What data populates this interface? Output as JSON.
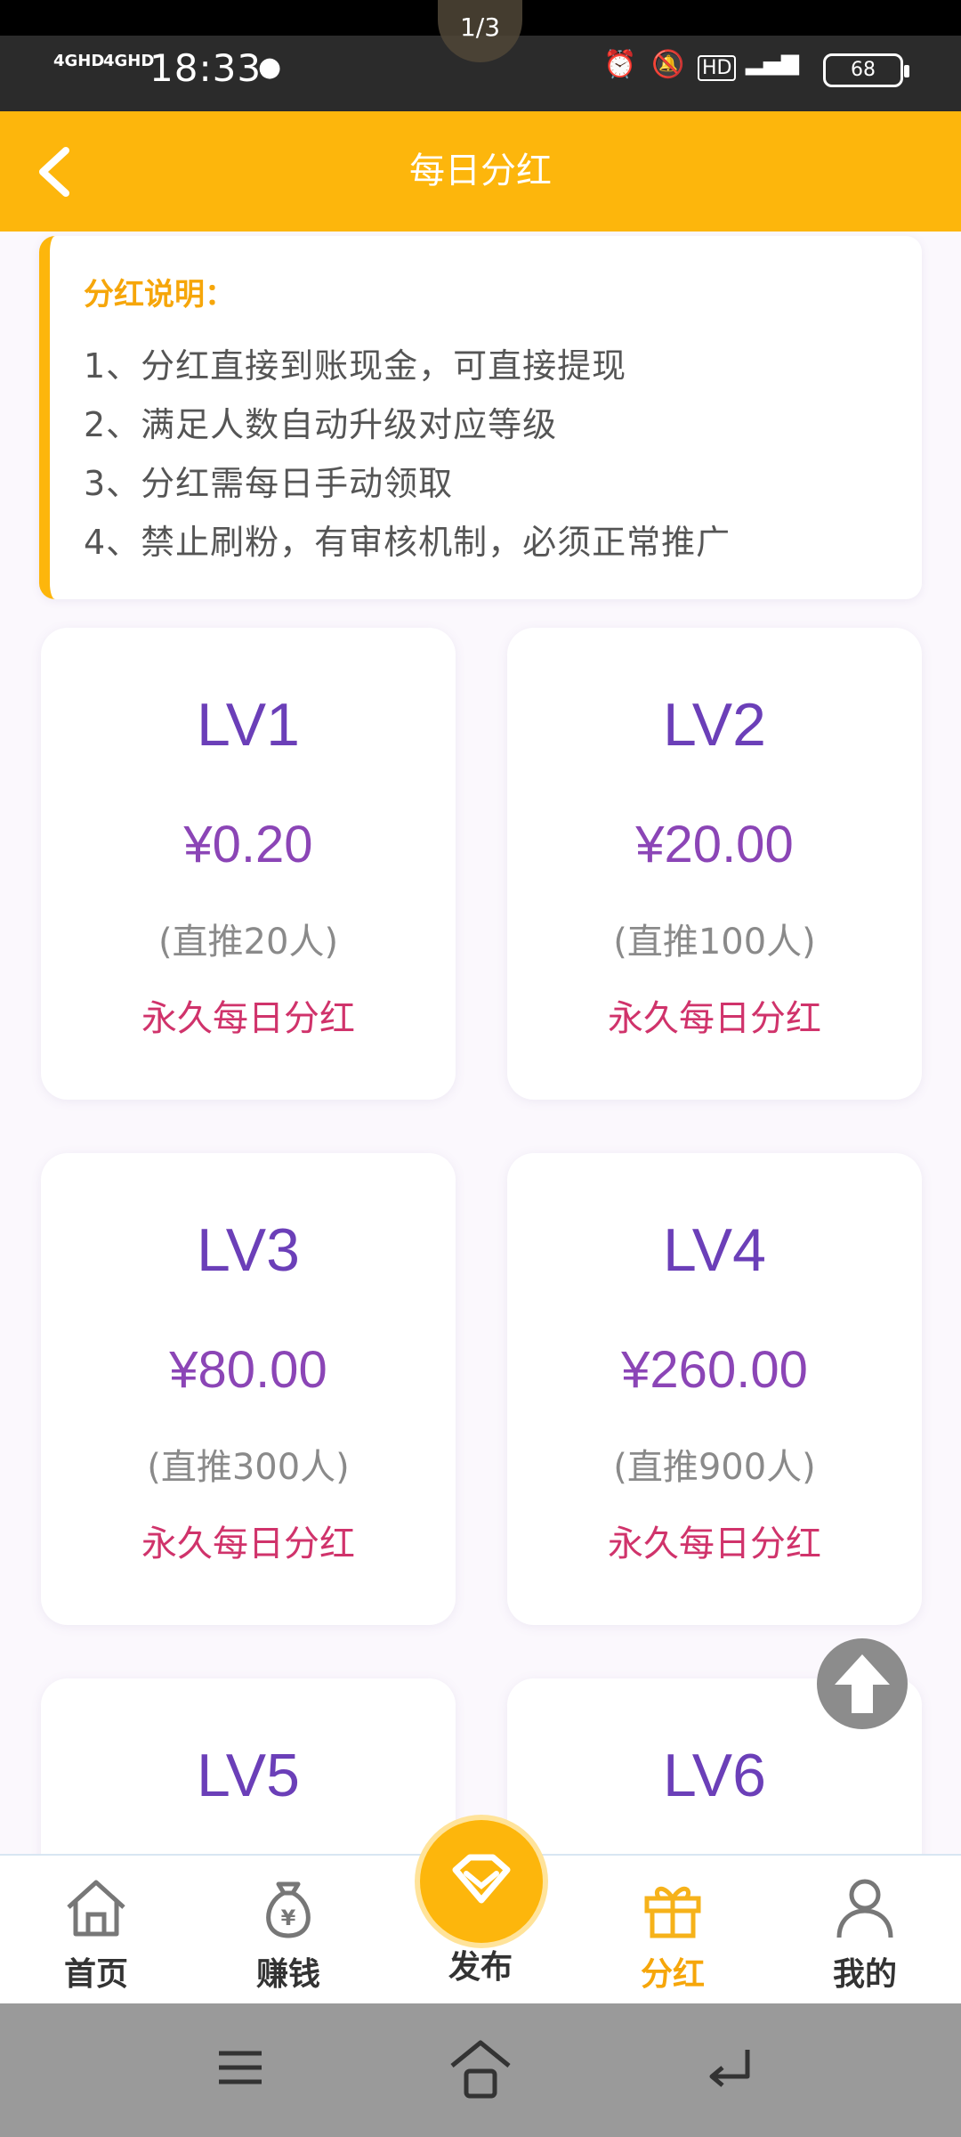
{
  "status_bar": {
    "network_1": "4GHD",
    "network_2": "4GHD",
    "time": "18:33",
    "battery": "68"
  },
  "header": {
    "title": "每日分红",
    "pager": "1/3"
  },
  "info": {
    "heading": "分红说明：",
    "lines": [
      "1、分红直接到账现金，可直接提现",
      "2、满足人数自动升级对应等级",
      "3、分红需每日手动领取",
      "4、禁止刷粉，有审核机制，必须正常推广"
    ]
  },
  "levels": [
    {
      "level": "LV1",
      "amount": "¥0.20",
      "requirement": "(直推20人)",
      "note": "永久每日分红"
    },
    {
      "level": "LV2",
      "amount": "¥20.00",
      "requirement": "(直推100人)",
      "note": "永久每日分红"
    },
    {
      "level": "LV3",
      "amount": "¥80.00",
      "requirement": "(直推300人)",
      "note": "永久每日分红"
    },
    {
      "level": "LV4",
      "amount": "¥260.00",
      "requirement": "(直推900人)",
      "note": "永久每日分红"
    },
    {
      "level": "LV5"
    },
    {
      "level": "LV6"
    }
  ],
  "tabbar": {
    "items": [
      {
        "label": "首页",
        "icon": "home-icon"
      },
      {
        "label": "赚钱",
        "icon": "money-bag-icon"
      },
      {
        "label": "发布",
        "icon": "diamond-icon"
      },
      {
        "label": "分红",
        "icon": "gift-icon"
      },
      {
        "label": "我的",
        "icon": "user-icon"
      }
    ],
    "active": "分红"
  },
  "colors": {
    "accent": "#fdb60c",
    "level_text": "#6b3fb8",
    "amount_text": "#8b45b6",
    "note_text": "#d0336b"
  }
}
